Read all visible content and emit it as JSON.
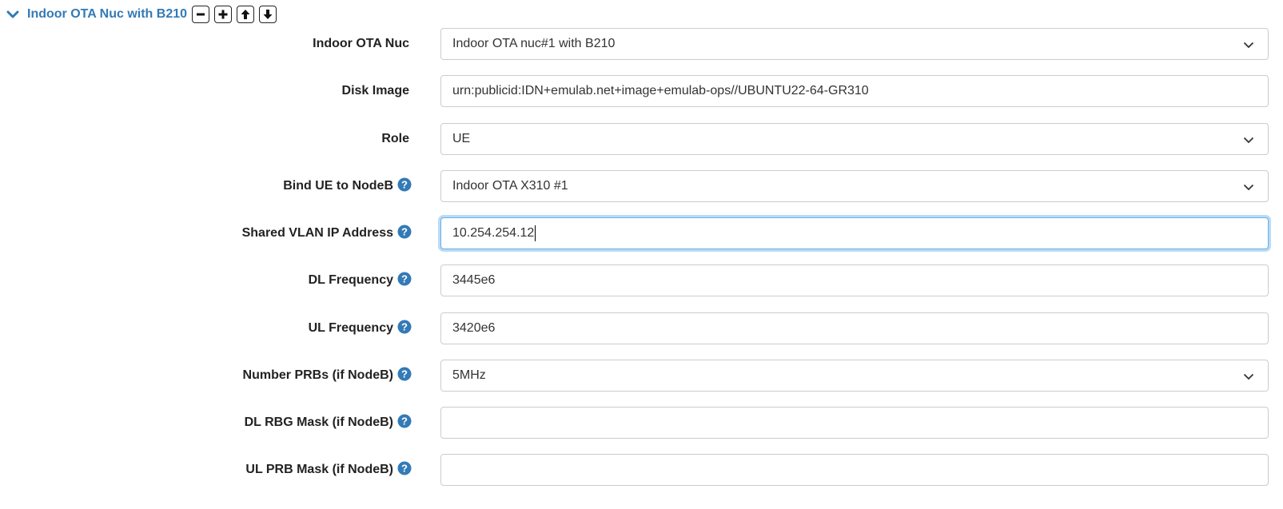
{
  "section": {
    "title": "Indoor OTA Nuc with B210",
    "accent_color": "#337ab7",
    "help_icon_color": "#337ab7",
    "buttons": [
      "remove-icon",
      "add-icon",
      "move-up-icon",
      "move-down-icon"
    ]
  },
  "fields": [
    {
      "label": "Indoor OTA Nuc",
      "type": "select",
      "value": "Indoor OTA nuc#1 with B210",
      "help": false
    },
    {
      "label": "Disk Image",
      "type": "text",
      "value": "urn:publicid:IDN+emulab.net+image+emulab-ops//UBUNTU22-64-GR310",
      "help": false
    },
    {
      "label": "Role",
      "type": "select",
      "value": "UE",
      "help": false
    },
    {
      "label": "Bind UE to NodeB",
      "type": "select",
      "value": "Indoor OTA X310 #1",
      "help": true
    },
    {
      "label": "Shared VLAN IP Address",
      "type": "text",
      "value": "10.254.254.12",
      "help": true,
      "focused": true
    },
    {
      "label": "DL Frequency",
      "type": "text",
      "value": "3445e6",
      "help": true
    },
    {
      "label": "UL Frequency",
      "type": "text",
      "value": "3420e6",
      "help": true
    },
    {
      "label": "Number PRBs (if NodeB)",
      "type": "select",
      "value": "5MHz",
      "help": true
    },
    {
      "label": "DL RBG Mask (if NodeB)",
      "type": "text",
      "value": "",
      "help": true
    },
    {
      "label": "UL PRB Mask (if NodeB)",
      "type": "text",
      "value": "",
      "help": true
    }
  ]
}
